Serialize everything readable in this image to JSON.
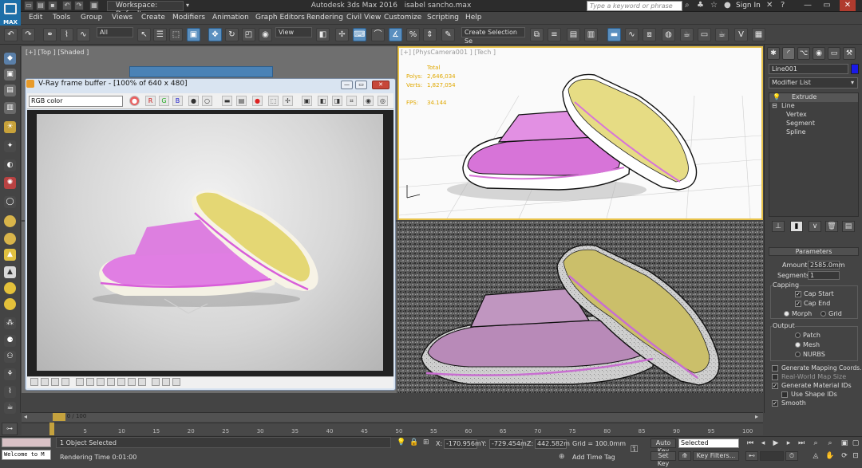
{
  "app": {
    "title": "Autodesk 3ds Max 2016",
    "filename": "isabel sancho.max",
    "workspace": "Workspace: Default",
    "search_placeholder": "Type a keyword or phrase",
    "signin": "Sign In",
    "logo_text": "MAX"
  },
  "menu": [
    "Edit",
    "Tools",
    "Group",
    "Views",
    "Create",
    "Modifiers",
    "Animation",
    "Graph Editors",
    "Rendering",
    "Civil View",
    "Customize",
    "Scripting",
    "Help"
  ],
  "toolbar": {
    "filter": "All",
    "refcoord": "View",
    "selection_set": "Create Selection Se"
  },
  "viewports": {
    "top_label": "[+] [Top ] [Shaded ]",
    "cam_label": "[+] [PhysCamera001 ] [Tech ]",
    "stats": {
      "total_label": "Total",
      "polys_label": "Polys:",
      "polys": "2,646,034",
      "verts_label": "Verts:",
      "verts": "1,827,054",
      "fps_label": "FPS:",
      "fps": "34.144"
    }
  },
  "vfb": {
    "title": "V-Ray frame buffer - [100% of 640 x 480]",
    "channel": "RGB color"
  },
  "command_panel": {
    "object_name": "Line001",
    "object_color": "#1a1ae8",
    "modifier_list": "Modifier List",
    "stack": [
      "Extrude",
      "Line",
      "Vertex",
      "Segment",
      "Spline"
    ],
    "parameters": {
      "header": "Parameters",
      "amount_label": "Amount:",
      "amount": "2585.0mm",
      "segments_label": "Segments:",
      "segments": "1",
      "capping_label": "Capping",
      "cap_start": "Cap Start",
      "cap_end": "Cap End",
      "morph": "Morph",
      "grid": "Grid",
      "output_label": "Output",
      "patch": "Patch",
      "mesh": "Mesh",
      "nurbs": "NURBS",
      "gen_mapping": "Generate Mapping Coords.",
      "real_world": "Real-World Map Size",
      "gen_matids": "Generate Material IDs",
      "use_shape_ids": "Use Shape IDs",
      "smooth": "Smooth"
    }
  },
  "timeline": {
    "frame": "0 / 100",
    "ticks": [
      "5",
      "10",
      "15",
      "20",
      "25",
      "30",
      "35",
      "40",
      "45",
      "50",
      "55",
      "60",
      "65",
      "70",
      "75",
      "80",
      "85",
      "90",
      "95",
      "100"
    ]
  },
  "status": {
    "welcome": "Welcome to M",
    "selected": "1 Object Selected",
    "rendering_time": "Rendering Time  0:01:00",
    "x_label": "X:",
    "x": "-170.956m",
    "y_label": "Y:",
    "y": "-729.454m",
    "z_label": "Z:",
    "z": "442.582m",
    "grid": "Grid = 100.0mm",
    "add_time_tag": "Add Time Tag",
    "auto_key": "Auto Key",
    "set_key": "Set Key",
    "selected_dd": "Selected",
    "key_filters": "Key Filters..."
  }
}
